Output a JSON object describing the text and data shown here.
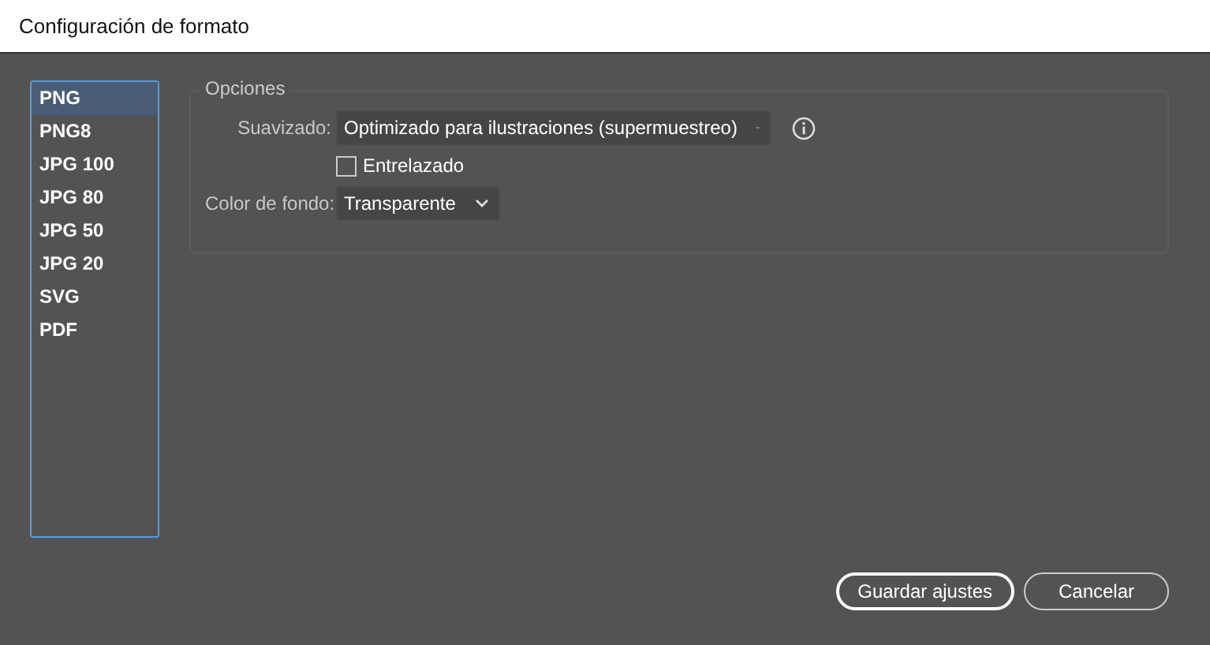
{
  "window": {
    "title": "Configuración de formato"
  },
  "formats": [
    {
      "label": "PNG",
      "selected": true
    },
    {
      "label": "PNG8",
      "selected": false
    },
    {
      "label": "JPG 100",
      "selected": false
    },
    {
      "label": "JPG 80",
      "selected": false
    },
    {
      "label": "JPG 50",
      "selected": false
    },
    {
      "label": "JPG 20",
      "selected": false
    },
    {
      "label": "SVG",
      "selected": false
    },
    {
      "label": "PDF",
      "selected": false
    }
  ],
  "options": {
    "title": "Opciones",
    "antialias": {
      "label": "Suavizado:",
      "value": "Optimizado para ilustraciones (supermuestreo)"
    },
    "interlaced": {
      "label": "Entrelazado",
      "checked": false
    },
    "background": {
      "label": "Color de fondo:",
      "value": "Transparente"
    }
  },
  "buttons": [
    {
      "label": "Guardar ajustes",
      "kind": "primary"
    },
    {
      "label": "Cancelar",
      "kind": "secondary"
    }
  ]
}
